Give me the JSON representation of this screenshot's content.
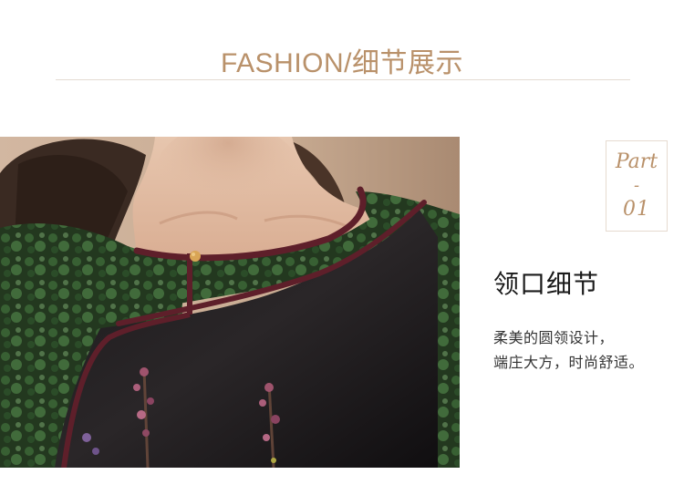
{
  "header": {
    "title": "FASHION/细节展示"
  },
  "part_badge": {
    "word": "Part",
    "dash": "-",
    "number": "01"
  },
  "detail": {
    "title": "领口细节",
    "description_lines": [
      "柔美的圆领设计，",
      "端庄大方，时尚舒适。"
    ]
  },
  "colors": {
    "accent": "#b9916a",
    "rule": "#e4dcd3",
    "trim": "#5e1f2a",
    "garment_black": "#141214",
    "garment_green": "#2f4a2c"
  }
}
